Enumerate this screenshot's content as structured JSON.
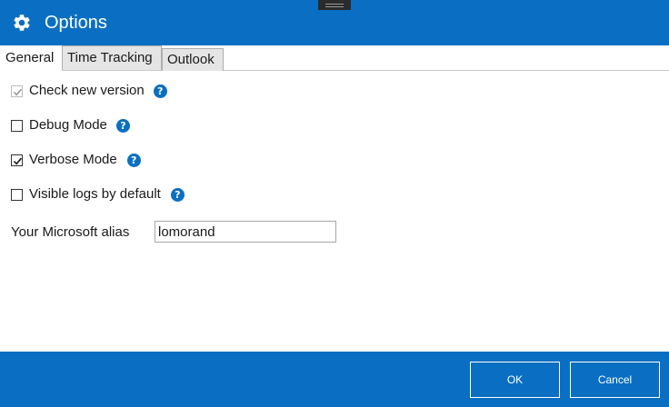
{
  "window": {
    "title": "Options",
    "icon": "gear-icon",
    "accent_color": "#0a6fc2"
  },
  "tabs": [
    {
      "label": "General",
      "selected": true
    },
    {
      "label": "Time Tracking",
      "selected": false
    },
    {
      "label": "Outlook",
      "selected": false
    }
  ],
  "general": {
    "options": [
      {
        "label": "Check new version",
        "checked": true,
        "disabled": true,
        "help": "?"
      },
      {
        "label": "Debug Mode",
        "checked": false,
        "disabled": false,
        "help": "?"
      },
      {
        "label": "Verbose Mode",
        "checked": true,
        "disabled": false,
        "help": "?"
      },
      {
        "label": "Visible logs by default",
        "checked": false,
        "disabled": false,
        "help": "?"
      }
    ],
    "alias": {
      "label": "Your Microsoft alias",
      "value": "lomorand"
    }
  },
  "footer": {
    "ok_label": "OK",
    "cancel_label": "Cancel"
  }
}
